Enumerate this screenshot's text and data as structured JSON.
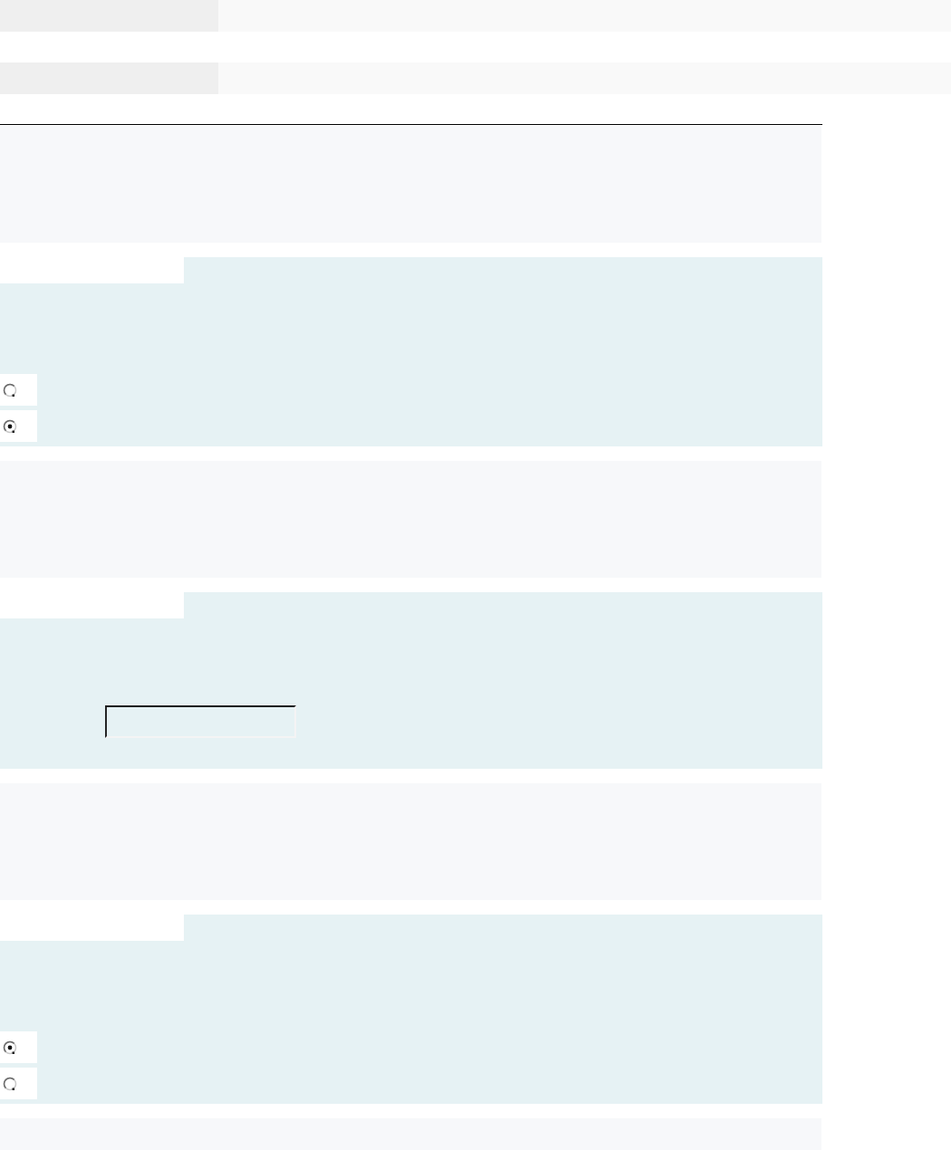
{
  "blocks": [
    {
      "kind": "prompt"
    },
    {
      "kind": "choice",
      "options": [
        {
          "selected": false
        },
        {
          "selected": true
        }
      ]
    },
    {
      "kind": "prompt"
    },
    {
      "kind": "text"
    },
    {
      "kind": "prompt"
    },
    {
      "kind": "choice",
      "options": [
        {
          "selected": true
        },
        {
          "selected": false
        }
      ]
    },
    {
      "kind": "prompt"
    }
  ]
}
